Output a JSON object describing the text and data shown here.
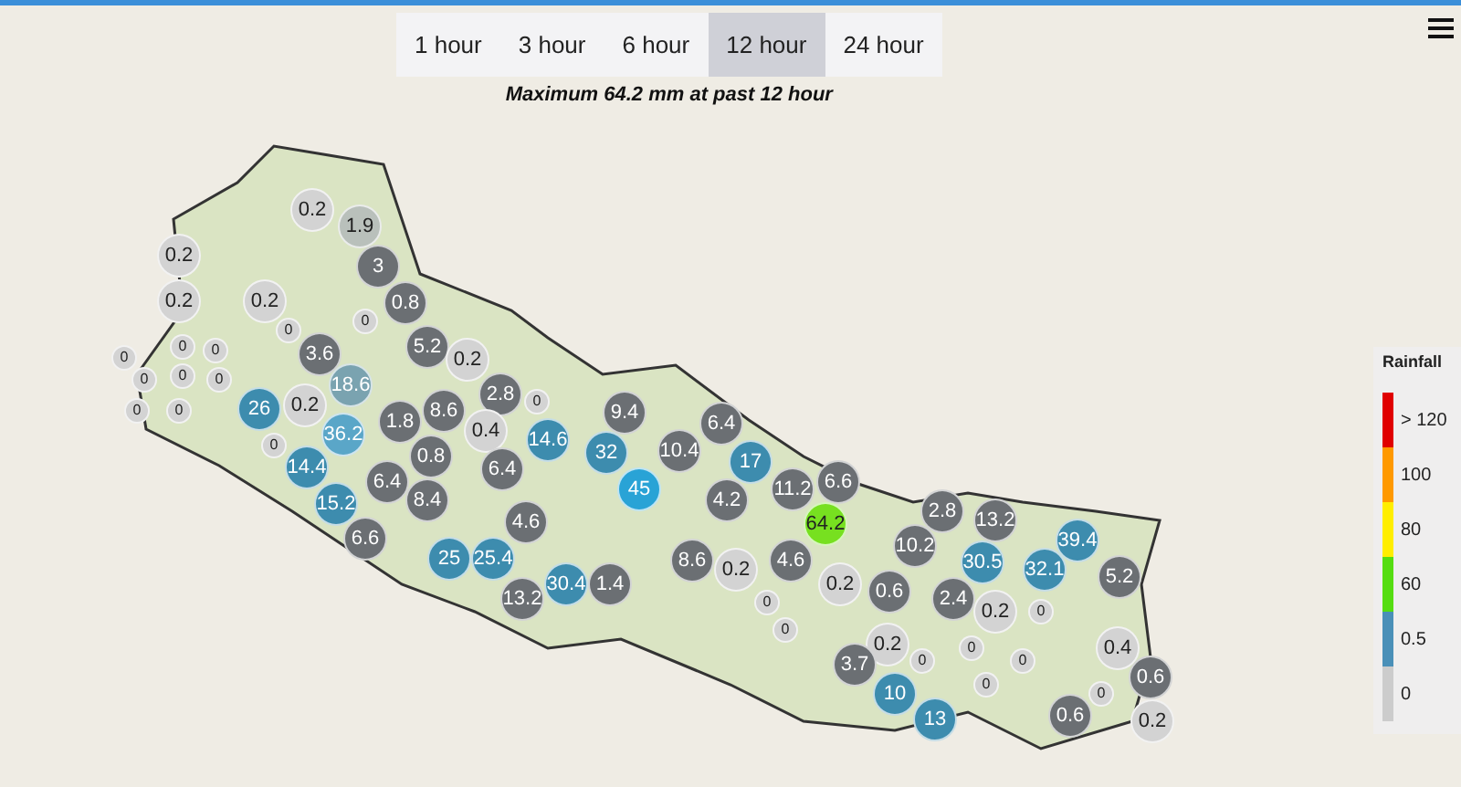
{
  "time_tabs": [
    {
      "label": "1 hour",
      "selected": false
    },
    {
      "label": "3 hour",
      "selected": false
    },
    {
      "label": "6 hour",
      "selected": false
    },
    {
      "label": "12 hour",
      "selected": true
    },
    {
      "label": "24 hour",
      "selected": false
    }
  ],
  "summary": "Maximum 64.2 mm at past 12 hour",
  "legend": {
    "title": "Rainfall",
    "items": [
      {
        "label": "> 120",
        "color": "#e00000"
      },
      {
        "label": "100",
        "color": "#ff9900"
      },
      {
        "label": "80",
        "color": "#ffee00"
      },
      {
        "label": "60",
        "color": "#55dd11"
      },
      {
        "label": "0.5",
        "color": "#4a90b8"
      },
      {
        "label": "0",
        "color": "#cccccc"
      }
    ]
  },
  "markers": [
    {
      "value": "0.2",
      "color": "#d3d3d3"
    },
    {
      "value": "1.9",
      "color": "#b9c0bb"
    },
    {
      "value": "0.2",
      "color": "#d3d3d3"
    },
    {
      "value": "0.2",
      "color": "#d3d3d3"
    },
    {
      "value": "0.2",
      "color": "#d3d3d3"
    },
    {
      "value": "3",
      "color": "#6b6f73"
    },
    {
      "value": "0.8",
      "color": "#6b6f73"
    },
    {
      "value": "5.2",
      "color": "#6b6f73"
    },
    {
      "value": "0.2",
      "color": "#d3d3d3"
    },
    {
      "value": "2.8",
      "color": "#6b6f73"
    },
    {
      "value": "3.6",
      "color": "#6b6f73"
    },
    {
      "value": "18.6",
      "color": "#7aa3b0"
    },
    {
      "value": "26",
      "color": "#3d8cae"
    },
    {
      "value": "0.2",
      "color": "#d3d3d3"
    },
    {
      "value": "36.2",
      "color": "#5aa6c8"
    },
    {
      "value": "1.8",
      "color": "#6b6f73"
    },
    {
      "value": "8.6",
      "color": "#6b6f73"
    },
    {
      "value": "0.4",
      "color": "#d3d3d3"
    },
    {
      "value": "0.8",
      "color": "#6b6f73"
    },
    {
      "value": "14.4",
      "color": "#3d8cae"
    },
    {
      "value": "15.2",
      "color": "#3d8cae"
    },
    {
      "value": "6.6",
      "color": "#6b6f73"
    },
    {
      "value": "6.4",
      "color": "#6b6f73"
    },
    {
      "value": "8.4",
      "color": "#6b6f73"
    },
    {
      "value": "14.6",
      "color": "#3d8cae"
    },
    {
      "value": "6.4",
      "color": "#6b6f73"
    },
    {
      "value": "9.4",
      "color": "#6b6f73"
    },
    {
      "value": "32",
      "color": "#3d8cae"
    },
    {
      "value": "10.4",
      "color": "#6b6f73"
    },
    {
      "value": "6.4",
      "color": "#6b6f73"
    },
    {
      "value": "45",
      "color": "#29a3d6"
    },
    {
      "value": "17",
      "color": "#3d8cae"
    },
    {
      "value": "11.2",
      "color": "#6b6f73"
    },
    {
      "value": "6.6",
      "color": "#6b6f73"
    },
    {
      "value": "64.2",
      "color": "#77e020"
    },
    {
      "value": "4.2",
      "color": "#6b6f73"
    },
    {
      "value": "4.6",
      "color": "#6b6f73"
    },
    {
      "value": "25",
      "color": "#3d8cae"
    },
    {
      "value": "25.4",
      "color": "#3d8cae"
    },
    {
      "value": "13.2",
      "color": "#6b6f73"
    },
    {
      "value": "30.4",
      "color": "#3d8cae"
    },
    {
      "value": "1.4",
      "color": "#6b6f73"
    },
    {
      "value": "8.6",
      "color": "#6b6f73"
    },
    {
      "value": "0.2",
      "color": "#d3d3d3"
    },
    {
      "value": "4.6",
      "color": "#6b6f73"
    },
    {
      "value": "10.2",
      "color": "#6b6f73"
    },
    {
      "value": "2.8",
      "color": "#6b6f73"
    },
    {
      "value": "13.2",
      "color": "#6b6f73"
    },
    {
      "value": "30.5",
      "color": "#3d8cae"
    },
    {
      "value": "2.4",
      "color": "#6b6f73"
    },
    {
      "value": "39.4",
      "color": "#3d8cae"
    },
    {
      "value": "32.1",
      "color": "#3d8cae"
    },
    {
      "value": "5.2",
      "color": "#6b6f73"
    },
    {
      "value": "0.2",
      "color": "#d3d3d3"
    },
    {
      "value": "0.6",
      "color": "#6b6f73"
    },
    {
      "value": "0.2",
      "color": "#d3d3d3"
    },
    {
      "value": "0.2",
      "color": "#d3d3d3"
    },
    {
      "value": "3.7",
      "color": "#6b6f73"
    },
    {
      "value": "10",
      "color": "#3d8cae"
    },
    {
      "value": "13",
      "color": "#3d8cae"
    },
    {
      "value": "0.4",
      "color": "#d3d3d3"
    },
    {
      "value": "0.6",
      "color": "#6b6f73"
    },
    {
      "value": "0.6",
      "color": "#6b6f73"
    },
    {
      "value": "0.2",
      "color": "#d3d3d3"
    },
    {
      "value": "0",
      "color": "#d3d3d3"
    },
    {
      "value": "0",
      "color": "#d3d3d3"
    },
    {
      "value": "0",
      "color": "#d3d3d3"
    },
    {
      "value": "0",
      "color": "#d3d3d3"
    },
    {
      "value": "0",
      "color": "#d3d3d3"
    },
    {
      "value": "0",
      "color": "#d3d3d3"
    },
    {
      "value": "0",
      "color": "#d3d3d3"
    },
    {
      "value": "0",
      "color": "#d3d3d3"
    },
    {
      "value": "0",
      "color": "#d3d3d3"
    },
    {
      "value": "0",
      "color": "#d3d3d3"
    },
    {
      "value": "0",
      "color": "#d3d3d3"
    },
    {
      "value": "0",
      "color": "#d3d3d3"
    },
    {
      "value": "0",
      "color": "#d3d3d3"
    },
    {
      "value": "0",
      "color": "#d3d3d3"
    },
    {
      "value": "0",
      "color": "#d3d3d3"
    },
    {
      "value": "0",
      "color": "#d3d3d3"
    },
    {
      "value": "0",
      "color": "#d3d3d3"
    },
    {
      "value": "0",
      "color": "#d3d3d3"
    },
    {
      "value": "0",
      "color": "#d3d3d3"
    },
    {
      "value": "0",
      "color": "#d3d3d3"
    }
  ]
}
